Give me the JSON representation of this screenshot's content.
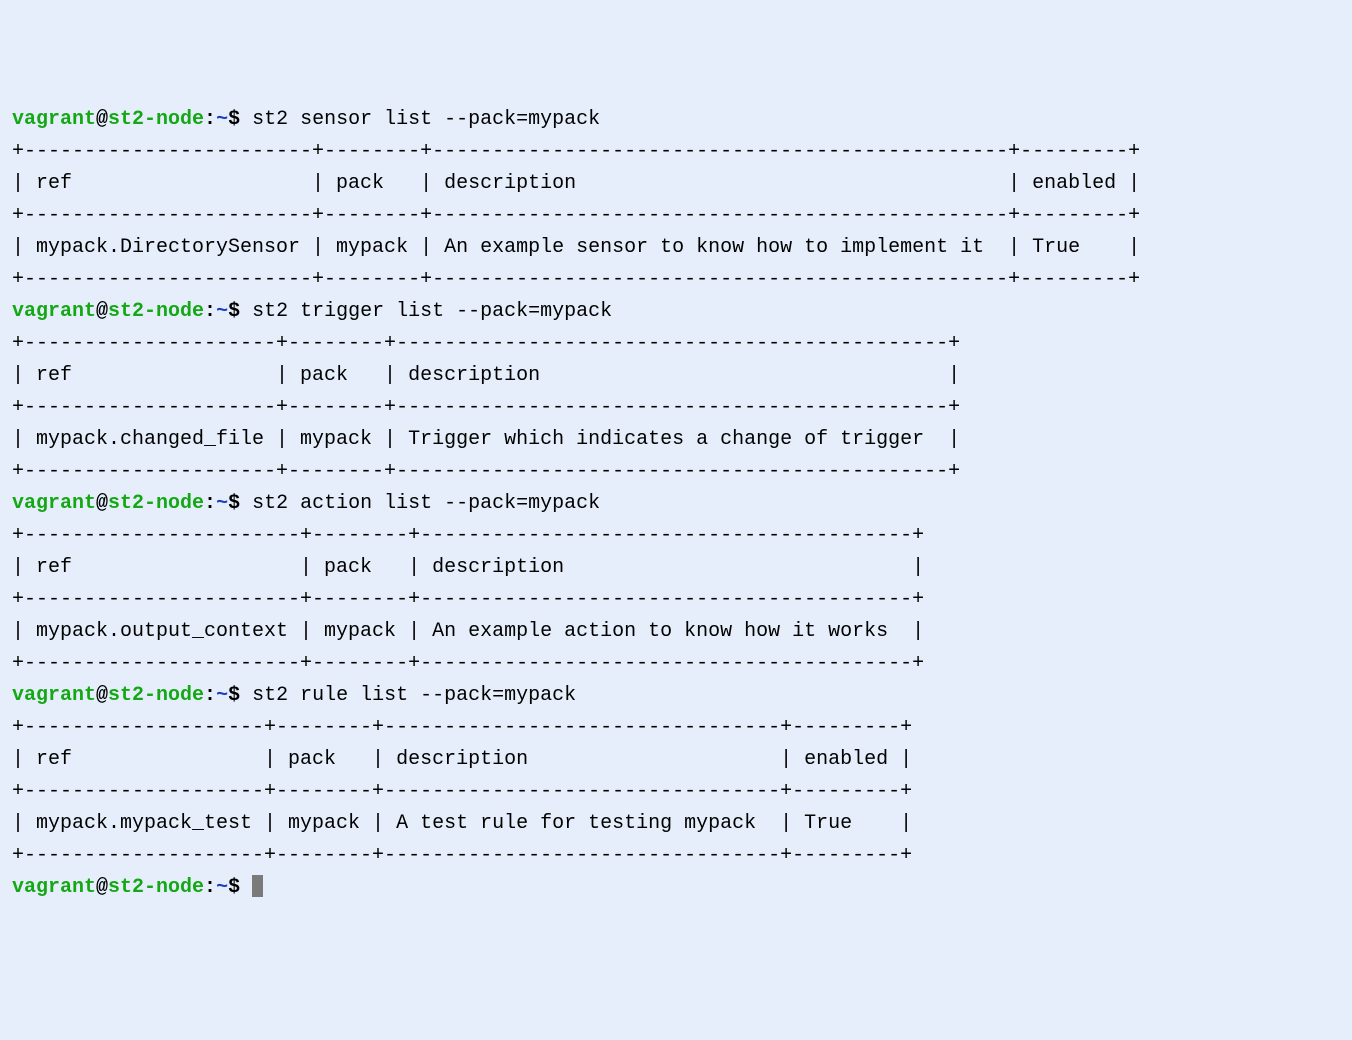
{
  "prompt": {
    "user": "vagrant",
    "host": "st2-node",
    "cwd": "~",
    "symbol": "$"
  },
  "sensor": {
    "command": "st2 sensor list --pack=mypack",
    "border_top": "+------------------------+--------+------------------------------------------------+---------+",
    "header": "| ref                    | pack   | description                                    | enabled |",
    "border_mid": "+------------------------+--------+------------------------------------------------+---------+",
    "row": "| mypack.DirectorySensor | mypack | An example sensor to know how to implement it  | True    |",
    "border_bot": "+------------------------+--------+------------------------------------------------+---------+"
  },
  "trigger": {
    "command": "st2 trigger list --pack=mypack",
    "border_top": "+---------------------+--------+----------------------------------------------+",
    "header": "| ref                 | pack   | description                                  |",
    "border_mid": "+---------------------+--------+----------------------------------------------+",
    "row": "| mypack.changed_file | mypack | Trigger which indicates a change of trigger  |",
    "border_bot": "+---------------------+--------+----------------------------------------------+"
  },
  "action": {
    "command": "st2 action list --pack=mypack",
    "border_top": "+-----------------------+--------+-----------------------------------------+",
    "header": "| ref                   | pack   | description                             |",
    "border_mid": "+-----------------------+--------+-----------------------------------------+",
    "row": "| mypack.output_context | mypack | An example action to know how it works  |",
    "border_bot": "+-----------------------+--------+-----------------------------------------+"
  },
  "rule": {
    "command": "st2 rule list --pack=mypack",
    "border_top": "+--------------------+--------+---------------------------------+---------+",
    "header": "| ref                | pack   | description                     | enabled |",
    "border_mid": "+--------------------+--------+---------------------------------+---------+",
    "row": "| mypack.mypack_test | mypack | A test rule for testing mypack  | True    |",
    "border_bot": "+--------------------+--------+---------------------------------+---------+"
  }
}
